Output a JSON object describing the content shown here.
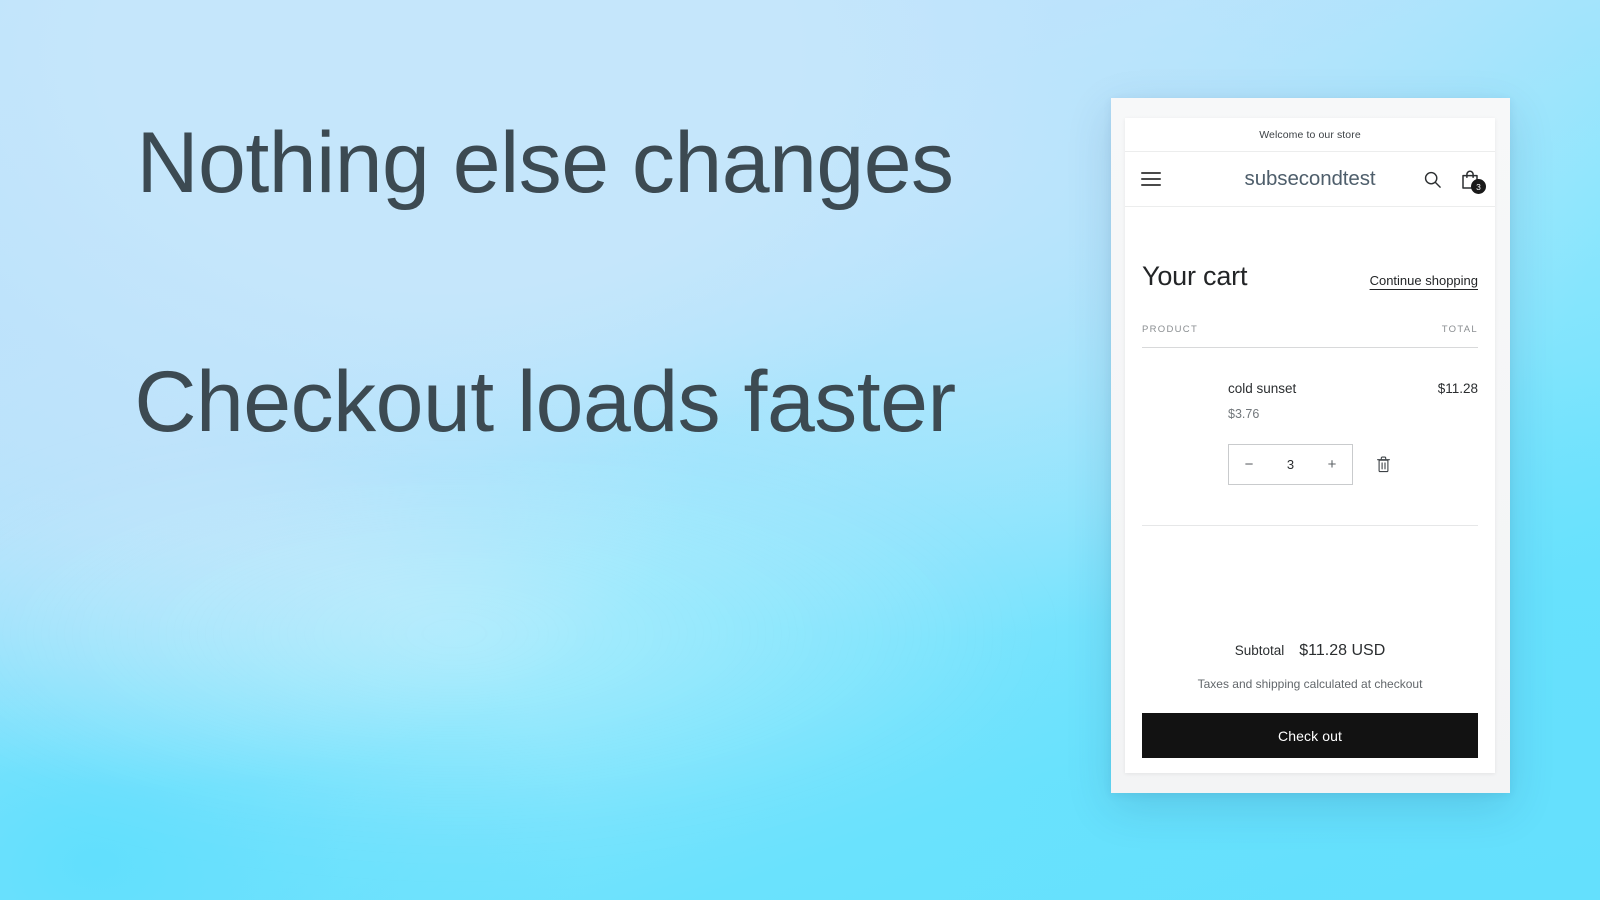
{
  "slide": {
    "headline_1": "Nothing else changes",
    "headline_2": "Checkout loads faster",
    "text_color": "#3c4a52",
    "background_from": "#bfe3fb",
    "background_to": "#61e0fd"
  },
  "storefront": {
    "announcement": "Welcome to our store",
    "store_name": "subsecondtest",
    "header": {
      "menu_icon": "hamburger-menu-icon",
      "search_icon": "search-icon",
      "cart_icon": "shopping-bag-icon",
      "cart_count": "3"
    },
    "cart": {
      "title": "Your cart",
      "continue_shopping": "Continue shopping",
      "columns": {
        "product": "PRODUCT",
        "total": "TOTAL"
      },
      "items": [
        {
          "title": "cold sunset",
          "unit_price": "$3.76",
          "line_total": "$11.28",
          "quantity": "3",
          "decrease_label": "−",
          "increase_label": "+",
          "remove_icon": "trash-icon"
        }
      ],
      "subtotal_label": "Subtotal",
      "subtotal_value": "$11.28 USD",
      "tax_note": "Taxes and shipping calculated at checkout",
      "checkout_label": "Check out",
      "checkout_bg": "#121212"
    }
  }
}
